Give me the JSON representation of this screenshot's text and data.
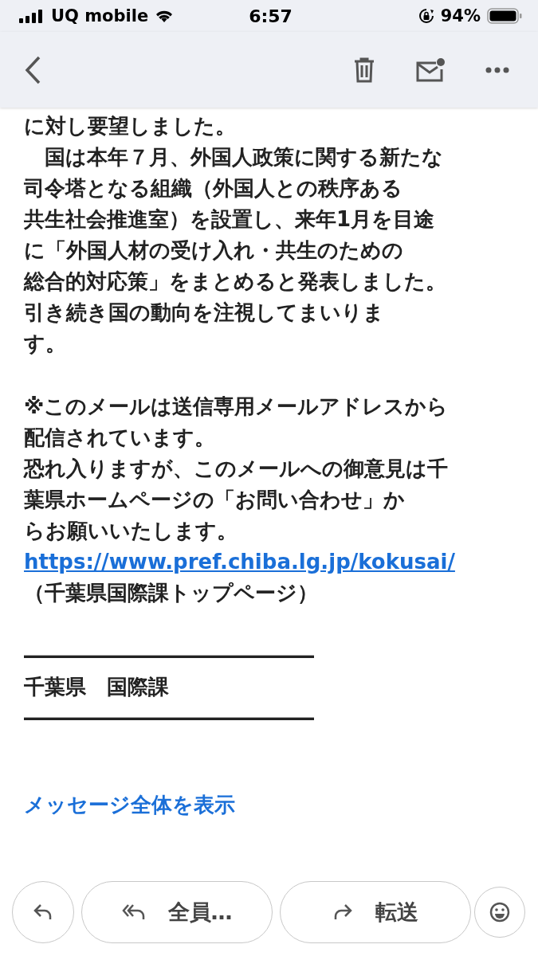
{
  "status_bar": {
    "carrier": "UQ mobile",
    "time": "6:57",
    "battery": "94%"
  },
  "body": {
    "paragraphs": [
      {
        "kind": "text",
        "lines": [
          "に対し要望しました。"
        ]
      },
      {
        "kind": "text",
        "lines": [
          "　国は本年７月、外国人政策に関する新たな",
          "司令塔となる組織（外国人との秩序ある",
          "共生社会推進室）を設置し、来年1月を目途",
          "に「外国人材の受け入れ・共生のための",
          "総合的対応策」をまとめると発表しました。",
          "引き続き国の動向を注視してまいりま",
          "す。"
        ]
      },
      {
        "kind": "gap"
      },
      {
        "kind": "text",
        "lines": [
          "※このメールは送信専用メールアドレスから",
          "配信されています。",
          "恐れ入りますが、このメールへの御意見は千",
          "葉県ホームページの「お問い合わせ」か",
          "らお願いいたします。"
        ]
      },
      {
        "kind": "link",
        "lines": [
          "https://www.pref.chiba.lg.jp/kokusai/"
        ]
      },
      {
        "kind": "text",
        "lines": [
          "（千葉県国際課トップページ）"
        ]
      },
      {
        "kind": "gap"
      },
      {
        "kind": "text",
        "lines": [
          "――――――――――――――",
          "千葉県　国際課",
          "――――――――――――――"
        ]
      }
    ]
  },
  "show_all": "メッセージ全体を表示",
  "actions": [
    {
      "kind": "reply"
    },
    {
      "kind": "reply_all",
      "label": "全員…"
    },
    {
      "kind": "forward",
      "label": "転送"
    },
    {
      "kind": "emoji"
    }
  ]
}
